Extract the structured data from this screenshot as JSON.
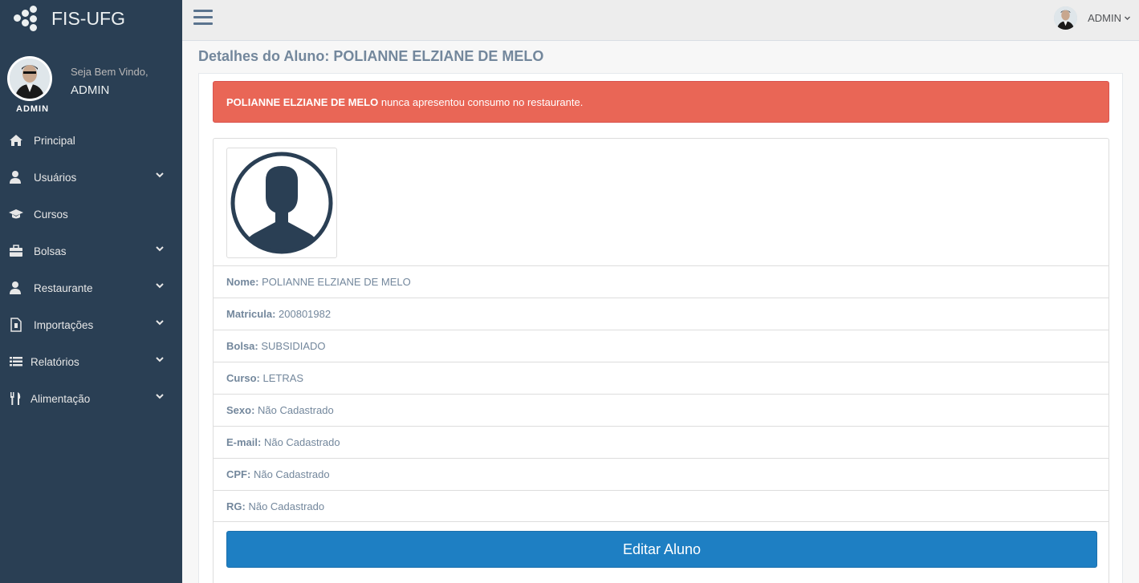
{
  "brand": {
    "name": "FIS-UFG"
  },
  "profile": {
    "welcome": "Seja Bem Vindo,",
    "name": "ADMIN",
    "role": "ADMIN"
  },
  "sidebar": {
    "items": [
      {
        "label": "Principal",
        "icon": "home-icon",
        "has_submenu": false
      },
      {
        "label": "Usuários",
        "icon": "user-icon",
        "has_submenu": true
      },
      {
        "label": "Cursos",
        "icon": "graduation-cap-icon",
        "has_submenu": false
      },
      {
        "label": "Bolsas",
        "icon": "briefcase-icon",
        "has_submenu": true
      },
      {
        "label": "Restaurante",
        "icon": "user-icon",
        "has_submenu": true
      },
      {
        "label": "Importações",
        "icon": "file-import-icon",
        "has_submenu": true
      },
      {
        "label": "Relatórios",
        "icon": "list-icon",
        "has_submenu": true
      },
      {
        "label": "Alimentação",
        "icon": "cutlery-icon",
        "has_submenu": true
      }
    ]
  },
  "topbar": {
    "user_label": "ADMIN"
  },
  "page": {
    "title": "Detalhes do Aluno: POLIANNE ELZIANE DE MELO"
  },
  "alert": {
    "name": "POLIANNE ELZIANE DE MELO",
    "message": " nunca apresentou consumo no restaurante."
  },
  "details": [
    {
      "label": "Nome:",
      "value": " POLIANNE ELZIANE DE MELO"
    },
    {
      "label": "Matricula:",
      "value": " 200801982"
    },
    {
      "label": "Bolsa:",
      "value": " SUBSIDIADO"
    },
    {
      "label": "Curso:",
      "value": " LETRAS"
    },
    {
      "label": "Sexo:",
      "value": " Não Cadastrado"
    },
    {
      "label": "E-mail:",
      "value": " Não Cadastrado"
    },
    {
      "label": "CPF:",
      "value": " Não Cadastrado"
    },
    {
      "label": "RG:",
      "value": " Não Cadastrado"
    }
  ],
  "actions": {
    "edit_label": "Editar Aluno"
  },
  "colors": {
    "sidebar": "#2a3f54",
    "alert": "#e96656",
    "primary": "#1e7fc3",
    "avatar_dark": "#2a3f54"
  }
}
